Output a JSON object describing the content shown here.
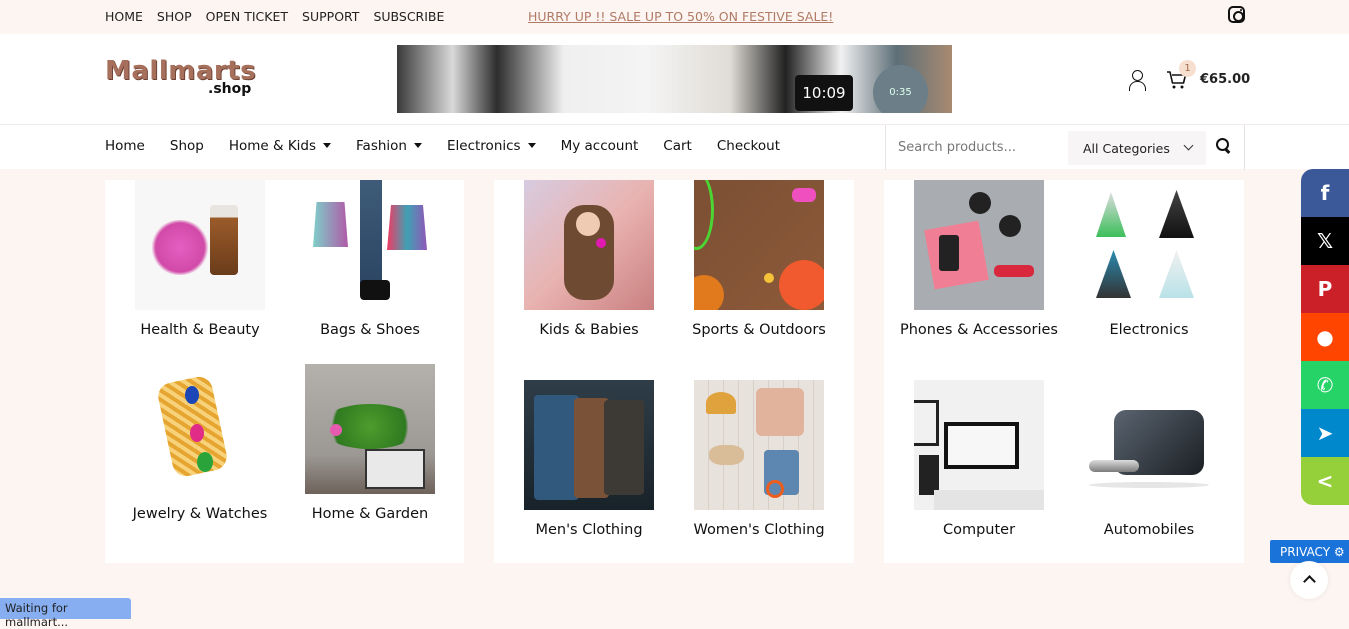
{
  "topbar": {
    "links": [
      "HOME",
      "SHOP",
      "OPEN TICKET",
      "SUPPORT",
      "SUBSCRIBE"
    ],
    "promo": "HURRY UP !! SALE UP TO 50% ON FESTIVE SALE!",
    "social_icon": "instagram-icon"
  },
  "header": {
    "logo_main": "Mallmarts",
    "logo_sub": ".shop",
    "banner_clock": "10:09",
    "banner_speaker": "0:35",
    "cart_count": "1",
    "cart_total": "€65.00"
  },
  "nav": {
    "items": [
      {
        "label": "Home",
        "dropdown": false
      },
      {
        "label": "Shop",
        "dropdown": false
      },
      {
        "label": "Home & Kids",
        "dropdown": true
      },
      {
        "label": "Fashion",
        "dropdown": true
      },
      {
        "label": "Electronics",
        "dropdown": true
      },
      {
        "label": "My account",
        "dropdown": false
      },
      {
        "label": "Cart",
        "dropdown": false
      },
      {
        "label": "Checkout",
        "dropdown": false
      }
    ],
    "search_placeholder": "Search products...",
    "category_selected": "All Categories"
  },
  "categories": [
    {
      "label": "Health & Beauty",
      "icon": "health-beauty-image"
    },
    {
      "label": "Bags & Shoes",
      "icon": "bags-shoes-image"
    },
    {
      "label": "Jewelry & Watches",
      "icon": "jewelry-watches-image"
    },
    {
      "label": "Home & Garden",
      "icon": "home-garden-image"
    },
    {
      "label": "Kids & Babies",
      "icon": "kids-babies-image"
    },
    {
      "label": "Sports & Outdoors",
      "icon": "sports-outdoors-image"
    },
    {
      "label": "Men's Clothing",
      "icon": "mens-clothing-image"
    },
    {
      "label": "Women's Clothing",
      "icon": "womens-clothing-image"
    },
    {
      "label": "Phones & Accessories",
      "icon": "phones-accessories-image"
    },
    {
      "label": "Electronics",
      "icon": "electronics-image"
    },
    {
      "label": "Computer",
      "icon": "computer-image"
    },
    {
      "label": "Automobiles",
      "icon": "automobiles-image"
    }
  ],
  "share": [
    {
      "name": "facebook",
      "glyph": "f",
      "color": "#3b5998"
    },
    {
      "name": "x",
      "glyph": "𝕏",
      "color": "#000000"
    },
    {
      "name": "pinterest",
      "glyph": "P",
      "color": "#cb2027"
    },
    {
      "name": "reddit",
      "glyph": "●",
      "color": "#ff4500"
    },
    {
      "name": "whatsapp",
      "glyph": "✆",
      "color": "#25d366"
    },
    {
      "name": "telegram",
      "glyph": "➤",
      "color": "#0088cc"
    },
    {
      "name": "share",
      "glyph": "<",
      "color": "#95d03a"
    }
  ],
  "privacy_label": "PRIVACY ⚙",
  "status_text": "Waiting for mallmart..."
}
